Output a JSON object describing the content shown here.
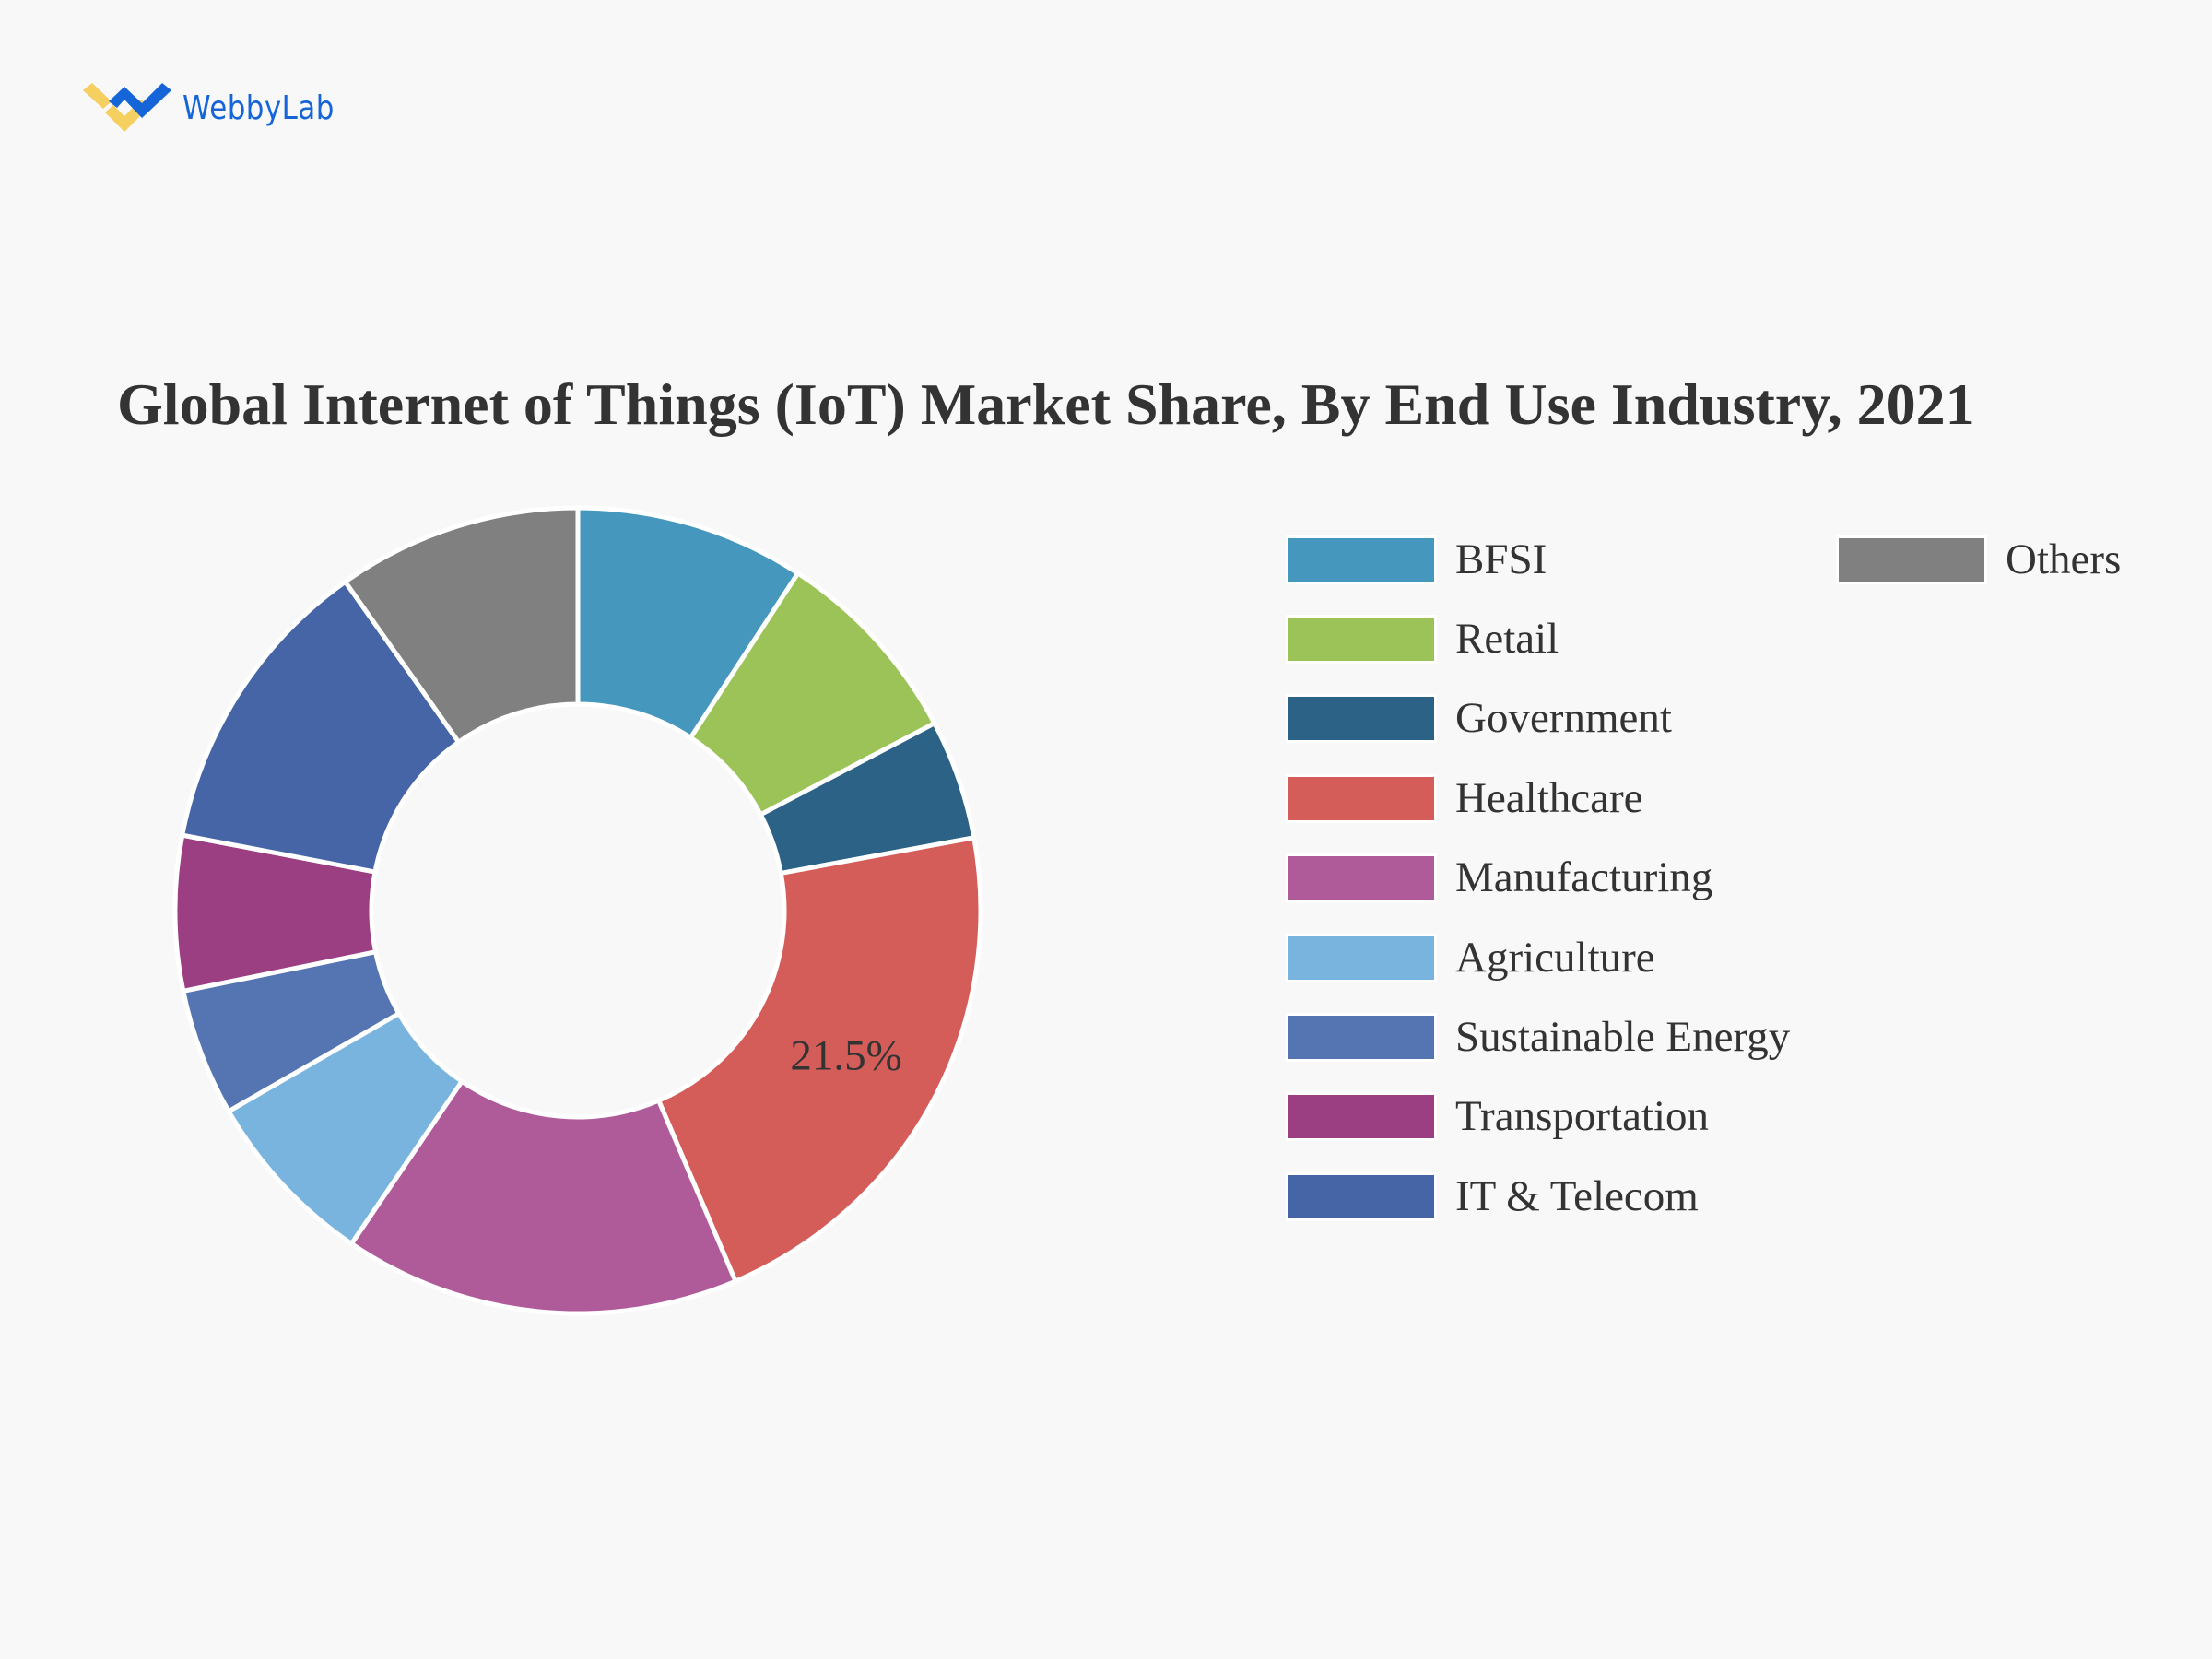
{
  "brand": {
    "name": "WebbyLab",
    "icon": "webbylab-logo-icon",
    "colors": {
      "primary": "#1565d8",
      "accent": "#f5cf60"
    }
  },
  "chart_data": {
    "type": "pie",
    "variant": "donut",
    "title": "Global Internet of Things (IoT) Market Share, By End Use Industry, 2021",
    "unit": "%",
    "categories": [
      "BFSI",
      "Retail",
      "Government",
      "Healthcare",
      "Manufacturing",
      "Agriculture",
      "Sustainable Energy",
      "Transportation",
      "IT & Telecom",
      "Others"
    ],
    "values": [
      9.2,
      8.1,
      4.8,
      21.5,
      15.9,
      7.2,
      5.1,
      6.2,
      12.2,
      9.8
    ],
    "colors": [
      "#4597bd",
      "#9bc357",
      "#2b6286",
      "#d45d5a",
      "#b05b99",
      "#79b4df",
      "#5575b2",
      "#9b3e82",
      "#4565a7",
      "#808080"
    ],
    "data_labels": [
      {
        "category": "Healthcare",
        "text": "21.5%"
      }
    ],
    "start_angle": "12 o'clock",
    "direction": "clockwise",
    "legend": {
      "placement": "right",
      "columns": [
        [
          "BFSI",
          "Retail",
          "Government",
          "Healthcare",
          "Manufacturing",
          "Agriculture",
          "Sustainable Energy",
          "Transportation",
          "IT & Telecom"
        ],
        [
          "Others"
        ]
      ]
    }
  }
}
